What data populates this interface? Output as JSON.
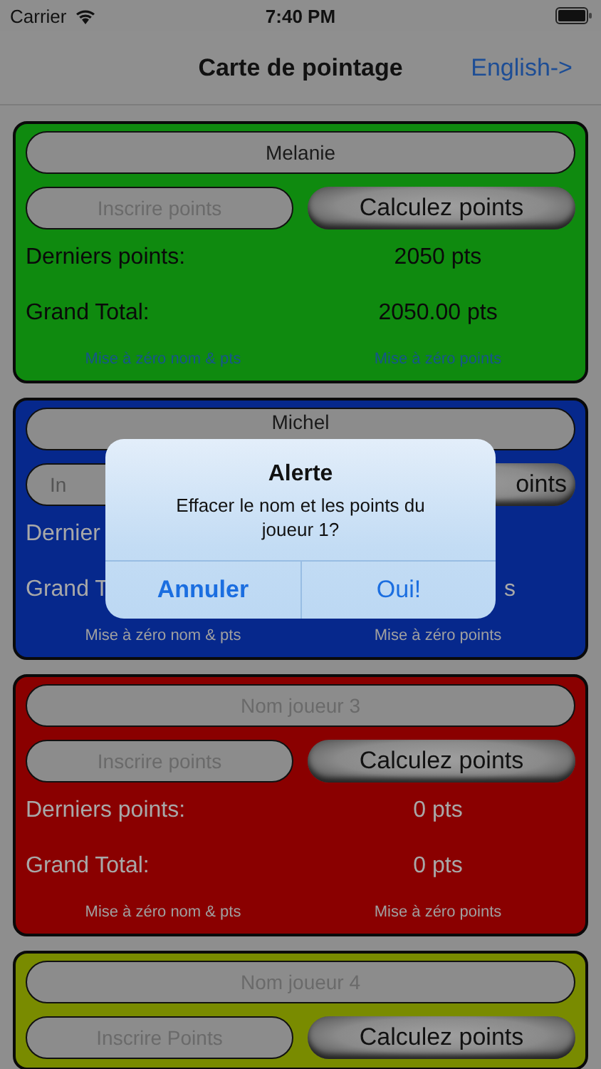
{
  "status_bar": {
    "carrier": "Carrier",
    "time": "7:40 PM"
  },
  "nav": {
    "title": "Carte de pointage",
    "language_link": "English->"
  },
  "cards": [
    {
      "color": "#0f8a0f",
      "kind": "dark-text",
      "covered": false,
      "name": "Melanie",
      "points_placeholder": "Inscrire points",
      "button": "Calculez points",
      "last_label": "Derniers points:",
      "last_value": "2050 pts",
      "total_label": "Grand Total:",
      "total_value": "2050.00 pts",
      "reset_all": "Mise à zéro nom & pts",
      "reset_points": "Mise à zéro points"
    },
    {
      "color": "#06288c",
      "kind": "light-text",
      "covered": true,
      "name": "Michel",
      "points_placeholder": "In",
      "button": "oints",
      "last_label": "Dernier",
      "total_label": "Grand T",
      "total_value": "s",
      "reset_all": "Mise à zéro nom & pts",
      "reset_points": "Mise à zéro points"
    },
    {
      "color": "#8a0000",
      "kind": "light-text",
      "covered": false,
      "name_placeholder": "Nom joueur 3",
      "points_placeholder": "Inscrire points",
      "button": "Calculez points",
      "last_label": "Derniers points:",
      "last_value": "0 pts",
      "total_label": "Grand Total:",
      "total_value": "0 pts",
      "reset_all": "Mise à zéro nom & pts",
      "reset_points": "Mise à zéro points"
    },
    {
      "color": "#798b00",
      "kind": "light-text",
      "covered": false,
      "name_placeholder": "Nom joueur 4",
      "points_placeholder": "Inscrire Points",
      "button": "Calculez points"
    }
  ],
  "alert": {
    "title": "Alerte",
    "message": "Effacer le nom et les points du joueur 1?",
    "buttons": [
      "Annuler",
      "Oui!"
    ]
  }
}
